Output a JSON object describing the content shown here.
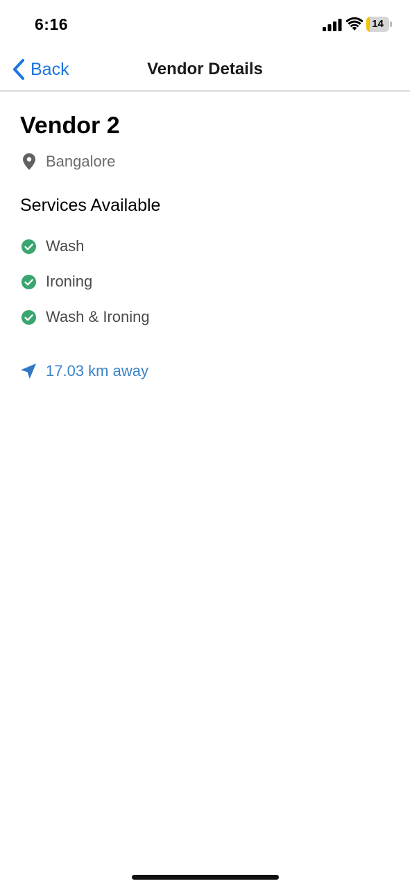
{
  "status_bar": {
    "time": "6:16",
    "battery_level": "14",
    "battery_fraction": 0.14,
    "battery_color": "#f5c400"
  },
  "nav": {
    "back_label": "Back",
    "title": "Vendor Details",
    "accent_color": "#1b74e4"
  },
  "vendor": {
    "name": "Vendor 2",
    "location": "Bangalore",
    "location_icon": "map-pin-icon"
  },
  "services": {
    "heading": "Services Available",
    "items": [
      {
        "label": "Wash",
        "icon": "check-circle-icon"
      },
      {
        "label": "Ironing",
        "icon": "check-circle-icon"
      },
      {
        "label": "Wash & Ironing",
        "icon": "check-circle-icon"
      }
    ],
    "check_color": "#3aa570"
  },
  "distance": {
    "text": "17.03 km away",
    "icon": "navigation-arrow-icon",
    "color": "#3a82c8"
  }
}
